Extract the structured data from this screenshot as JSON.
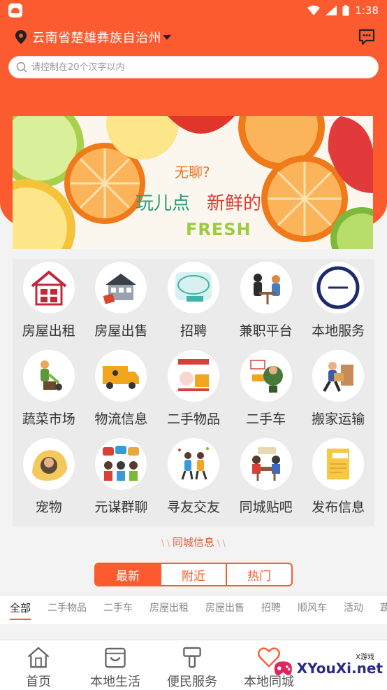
{
  "status_bar": {
    "time": "1:38"
  },
  "header": {
    "location": "云南省楚雄彝族自治州",
    "search_placeholder": "请控制在20个汉字以内"
  },
  "banner": {
    "line1": "无聊?",
    "line2a": "玩儿点",
    "line2b": "新鲜的",
    "line3": "FRESH"
  },
  "grid_items": [
    {
      "label": "房屋出租",
      "icon": "house-rent-icon"
    },
    {
      "label": "房屋出售",
      "icon": "house-sale-icon"
    },
    {
      "label": "招聘",
      "icon": "recruit-icon"
    },
    {
      "label": "兼职平台",
      "icon": "part-time-icon"
    },
    {
      "label": "本地服务",
      "icon": "local-service-icon"
    },
    {
      "label": "蔬菜市场",
      "icon": "vegetable-icon"
    },
    {
      "label": "物流信息",
      "icon": "logistics-icon"
    },
    {
      "label": "二手物品",
      "icon": "flea-market-icon"
    },
    {
      "label": "二手车",
      "icon": "used-car-icon"
    },
    {
      "label": "搬家运输",
      "icon": "moving-icon"
    },
    {
      "label": "宠物",
      "icon": "pet-icon"
    },
    {
      "label": "元谋群聊",
      "icon": "group-chat-icon"
    },
    {
      "label": "寻友交友",
      "icon": "friends-icon"
    },
    {
      "label": "同城贴吧",
      "icon": "forum-icon"
    },
    {
      "label": "发布信息",
      "icon": "publish-icon"
    }
  ],
  "section": {
    "title": "同城信息"
  },
  "segment": [
    "最新",
    "附近",
    "热门"
  ],
  "category_tabs": [
    "全部",
    "二手物品",
    "二手车",
    "房屋出租",
    "房屋出售",
    "招聘",
    "顺风车",
    "活动",
    "蔬"
  ],
  "bottom_nav": [
    {
      "label": "首页",
      "icon": "home-icon"
    },
    {
      "label": "本地生活",
      "icon": "shopping-bag-icon"
    },
    {
      "label": "便民服务",
      "icon": "hammer-icon"
    },
    {
      "label": "本地同城",
      "icon": "heart-icon"
    }
  ],
  "watermark": {
    "text": "XYouXi.net",
    "small": "X游戏"
  },
  "colors": {
    "accent": "#fc5a2f"
  }
}
